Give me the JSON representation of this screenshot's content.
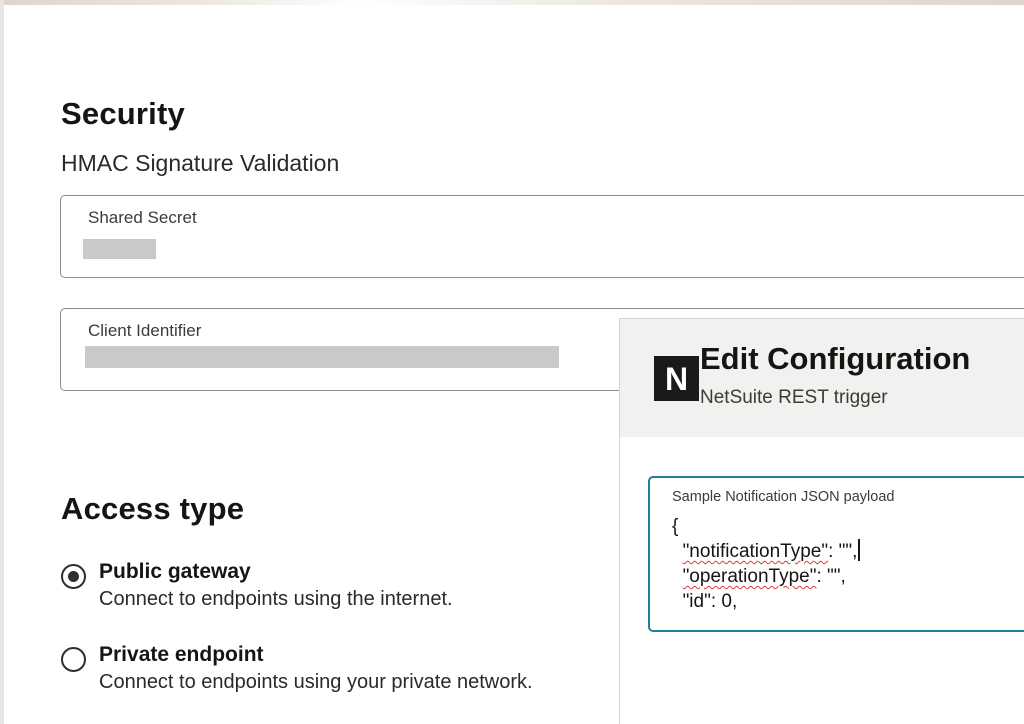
{
  "security": {
    "title": "Security",
    "subtitle": "HMAC Signature Validation",
    "shared_secret": {
      "label": "Shared Secret"
    },
    "client_identifier": {
      "label": "Client Identifier"
    }
  },
  "access_type": {
    "title": "Access type",
    "options": [
      {
        "label": "Public gateway",
        "description": "Connect to endpoints using the internet.",
        "selected": true
      },
      {
        "label": "Private endpoint",
        "description": "Connect to endpoints using your private network.",
        "selected": false
      }
    ]
  },
  "edit_panel": {
    "logo_letter": "N",
    "title": "Edit Configuration",
    "subtitle": "NetSuite REST trigger",
    "json_field": {
      "label": "Sample Notification JSON payload",
      "line_open": "{",
      "line1_key": "\"notificationType\"",
      "line1_rest": ": \"\",",
      "line2_key": "\"operationType\"",
      "line2_rest": ": \"\",",
      "line3": "\"id\": 0,"
    }
  }
}
